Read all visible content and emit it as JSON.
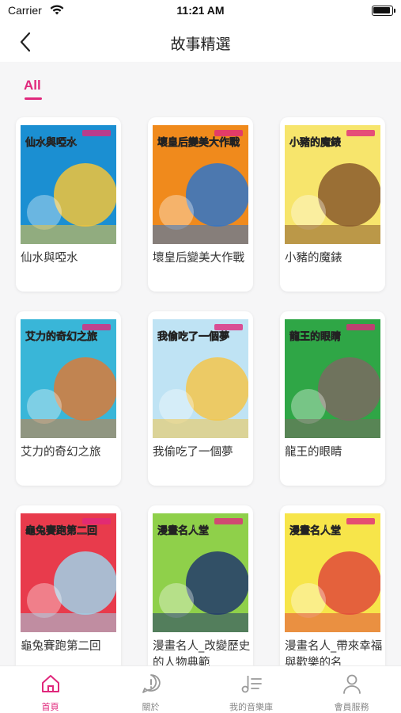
{
  "status_bar": {
    "carrier": "Carrier",
    "time": "11:21 AM"
  },
  "nav": {
    "title": "故事精選"
  },
  "filter": {
    "active_tab": "All"
  },
  "stories": [
    {
      "title": "仙水與啞水",
      "cover_text": "仙水與啞水",
      "colors": [
        "#1b8fd2",
        "#f2c43a"
      ]
    },
    {
      "title": "壞皇后變美大作戰",
      "cover_text": "壞皇后變美大作戰",
      "colors": [
        "#f08a1c",
        "#2f74c9"
      ]
    },
    {
      "title": "小豬的魔錶",
      "cover_text": "小豬的魔錶",
      "colors": [
        "#f7e56c",
        "#8a5a2b"
      ]
    },
    {
      "title": "艾力的奇幻之旅",
      "cover_text": "艾力的奇幻之旅",
      "colors": [
        "#39b6d8",
        "#d97b3a"
      ]
    },
    {
      "title": "我偷吃了一個夢",
      "cover_text": "我偷吃了一個夢",
      "colors": [
        "#bfe3f4",
        "#f3c64b"
      ]
    },
    {
      "title": "龍王的眼睛",
      "cover_text": "龍王的眼睛",
      "colors": [
        "#2fa646",
        "#7a6a62"
      ]
    },
    {
      "title": "龜兔賽跑第二回",
      "cover_text": "龜兔賽跑第二回",
      "colors": [
        "#e83b4c",
        "#9fd2e8"
      ]
    },
    {
      "title": "漫畫名人_改變歷史的人物典範",
      "cover_text": "漫畫名人堂",
      "colors": [
        "#8fd04a",
        "#223a6b"
      ]
    },
    {
      "title": "漫畫名人_帶來幸福與歡樂的名",
      "cover_text": "漫畫名人堂",
      "colors": [
        "#f7e54a",
        "#e04a3a"
      ]
    }
  ],
  "tab_bar": {
    "items": [
      {
        "label": "首頁",
        "icon": "home-icon"
      },
      {
        "label": "關於",
        "icon": "info-icon"
      },
      {
        "label": "我的音樂庫",
        "icon": "music-library-icon"
      },
      {
        "label": "會員服務",
        "icon": "member-icon"
      }
    ]
  },
  "theme": {
    "accent": "#e0287c",
    "background": "#f6f6f7"
  }
}
